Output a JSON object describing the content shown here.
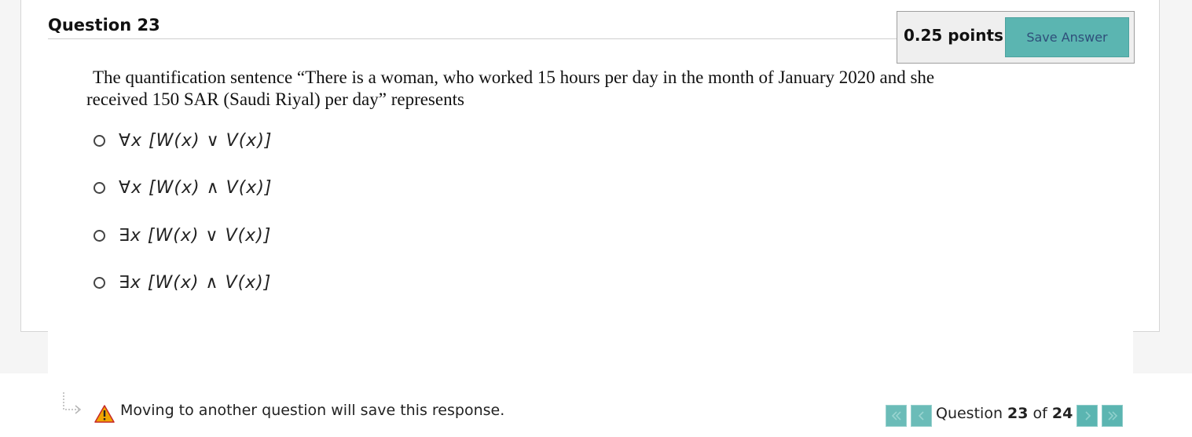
{
  "question": {
    "title": "Question 23",
    "points": "0.25 points",
    "save_label": "Save Answer",
    "text_line1": "The quantification sentence “There is a woman, who worked 15 hours per day in the month of January 2020 and she",
    "text_line2": "received 150 SAR (Saudi Riyal) per day” represents",
    "options": [
      {
        "label": "∀x [W(x) ∨ V(x)]",
        "selected": false
      },
      {
        "label": "∀x [W(x) ∧ V(x)]",
        "selected": false
      },
      {
        "label": "∃x [W(x) ∨ V(x)]",
        "selected": false
      },
      {
        "label": "∃x [W(x) ∧ V(x)]",
        "selected": false
      }
    ]
  },
  "footer": {
    "warning": "Moving to another question will save this response.",
    "counter_prefix": "Question",
    "current": "23",
    "counter_sep": "of",
    "total": "24"
  },
  "icons": {
    "warning": "warning-triangle-icon",
    "arrow": "return-arrow-icon",
    "first": "double-chevron-left-icon",
    "prev": "chevron-left-icon",
    "next": "chevron-right-icon",
    "last": "double-chevron-right-icon"
  },
  "colors": {
    "accent": "#5bb5b1",
    "save_text": "#2f4f7a",
    "warning": "#f0a500"
  }
}
